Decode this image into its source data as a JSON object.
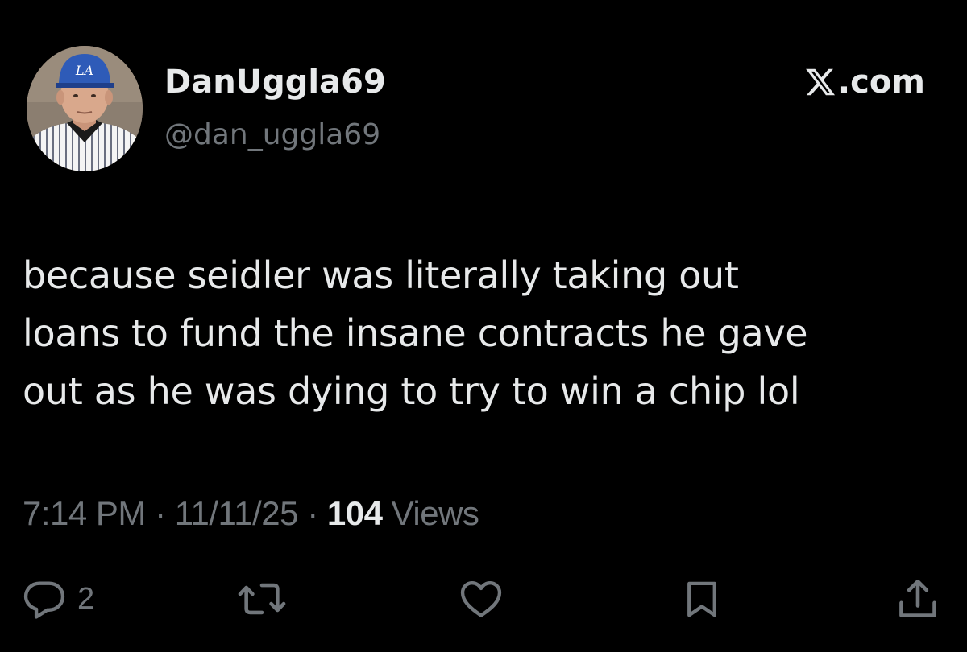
{
  "profile": {
    "display_name": "DanUggla69",
    "handle": "@dan_uggla69",
    "avatar_icon": "profile-photo-baseball-player",
    "cap_logo_text": "LA"
  },
  "source": {
    "label": ".com",
    "logo_icon": "x-logo-icon"
  },
  "tweet": {
    "lines": [
      "because seidler was literally taking out",
      "loans to fund the insane contracts he gave",
      "out as he was dying to try to win a chip lol"
    ]
  },
  "meta": {
    "time": "7:14 PM",
    "separator": "·",
    "date": "11/11/25",
    "views_count": "104",
    "views_label": "Views"
  },
  "actions": {
    "reply_count": "2",
    "icons": [
      "reply-icon",
      "retweet-icon",
      "like-icon",
      "bookmark-icon",
      "share-icon"
    ]
  },
  "colors": {
    "background": "#000000",
    "primary_text": "#e7e9ea",
    "secondary_text": "#71767b"
  }
}
